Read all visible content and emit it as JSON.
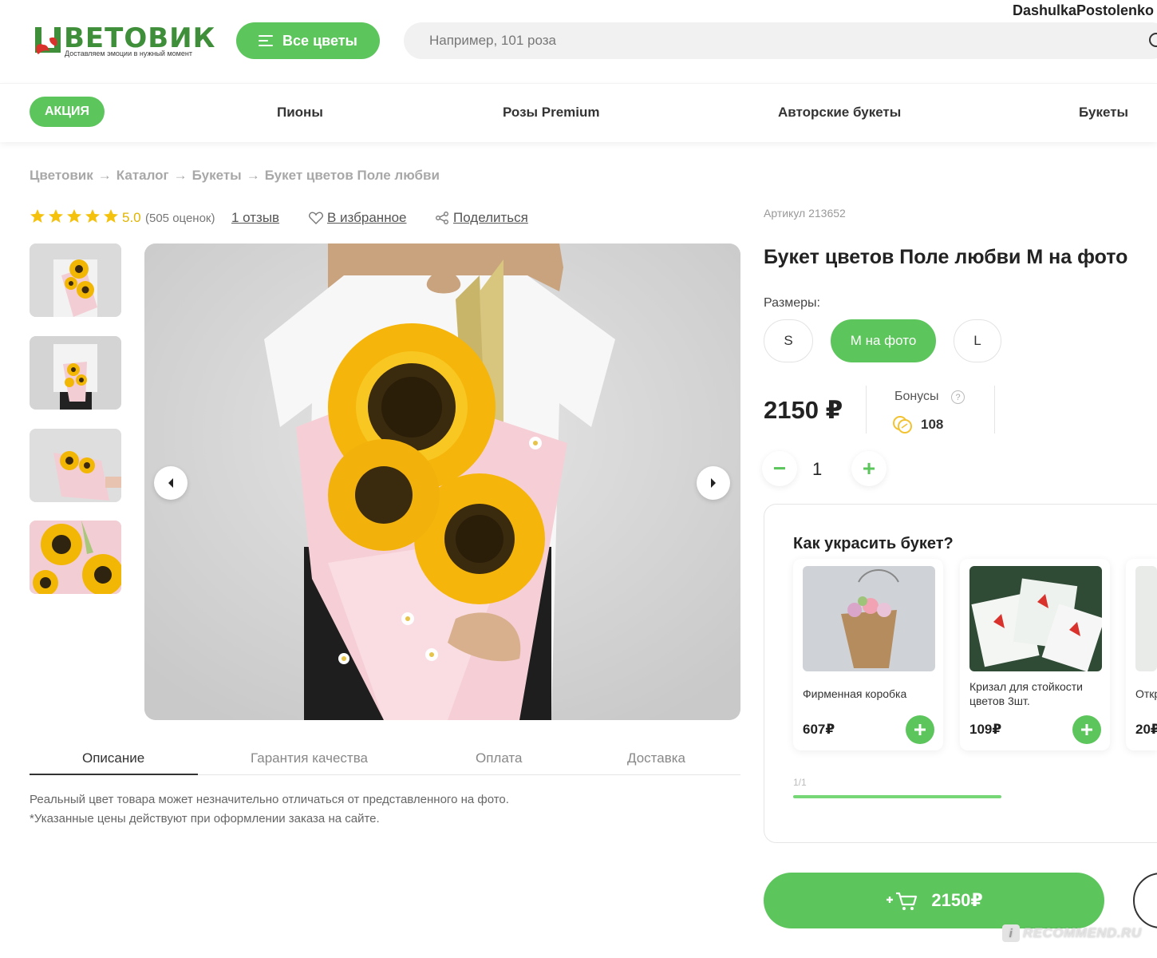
{
  "user": {
    "name": "DashulkaPostolenko"
  },
  "logo": {
    "wordmark": "ВЕТОВИК",
    "tagline": "Доставляем эмоции в нужный момент"
  },
  "header": {
    "all_flowers_label": "Все цветы",
    "search_placeholder": "Например, 101 роза"
  },
  "nav": {
    "promo_label": "АКЦИЯ",
    "links": [
      "Пионы",
      "Розы Premium",
      "Авторские букеты",
      "Букеты"
    ]
  },
  "breadcrumb": {
    "items": [
      "Цветовик",
      "Каталог",
      "Букеты",
      "Букет цветов Поле любви"
    ],
    "separator": "→"
  },
  "rating": {
    "stars": 5,
    "value": "5.0",
    "count_text": "(505 оценок)",
    "reviews_link": "1 отзыв",
    "favorite_label": "В избранное",
    "share_label": "Поделиться",
    "star_color": "#f4c20d"
  },
  "tabs": {
    "items": [
      "Описание",
      "Гарантия качества",
      "Оплата",
      "Доставка"
    ],
    "active": 0
  },
  "description": {
    "line1": "Реальный цвет товара может незначительно отличаться от представленного на фото.",
    "line2": "*Указанные цены действуют при оформлении заказа на сайте."
  },
  "product": {
    "article": "Артикул 213652",
    "title": "Букет цветов Поле любви М на фото",
    "sizes_label": "Размеры:",
    "sizes": [
      "S",
      "М на фото",
      "L"
    ],
    "selected_size": 1,
    "price": "2150 ₽",
    "bonus_label": "Бонусы",
    "bonus_help": "?",
    "bonus_value": "108",
    "quantity": "1",
    "minus": "−",
    "plus": "+"
  },
  "upsell": {
    "title": "Как украсить букет?",
    "items": [
      {
        "name": "Фирменная коробка",
        "price": "607₽"
      },
      {
        "name": "Кризал для стойкости цветов 3шт.",
        "price": "109₽"
      },
      {
        "name": "Откр",
        "price": "20₽"
      }
    ],
    "pager": "1/1"
  },
  "cart": {
    "label": "2150₽",
    "icon": "cart-plus-icon"
  },
  "watermark": {
    "text": "RECOMMEND.RU",
    "badge": "i"
  },
  "colors": {
    "accent": "#5cc55c",
    "brand_green": "#3f8f3a",
    "brand_red": "#d9312b"
  }
}
